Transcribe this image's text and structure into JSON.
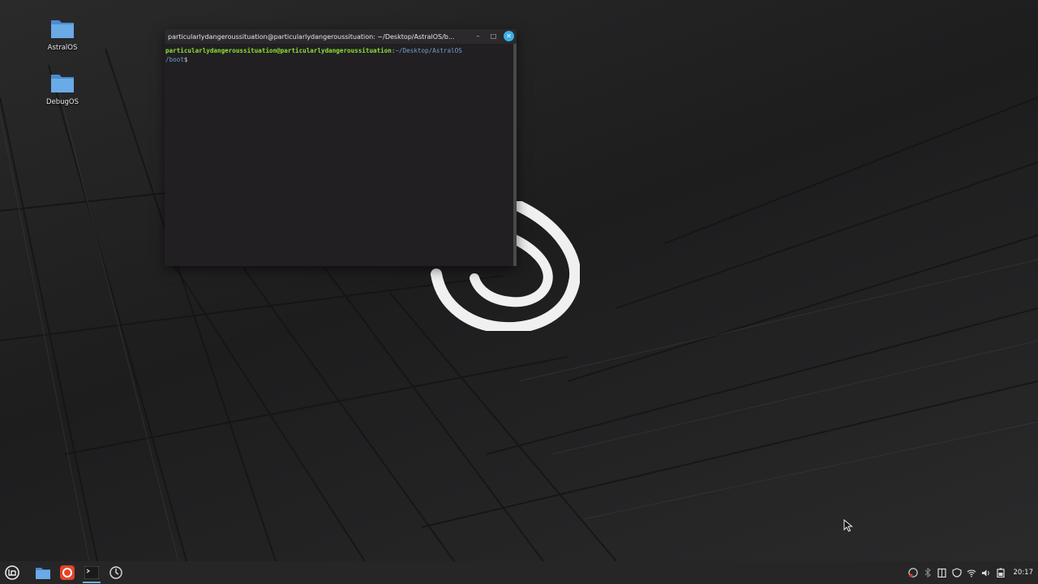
{
  "desktop": {
    "icons": [
      {
        "label": "AstralOS",
        "icon": "folder-icon"
      },
      {
        "label": "DebugOS",
        "icon": "folder-icon"
      }
    ]
  },
  "terminal": {
    "title": "particularlydangeroussituation@particularlydangeroussituation: ~/Desktop/AstralOS/b...",
    "prompt_user": "particularlydangeroussituation@particularlydangeroussituation",
    "prompt_sep": ":",
    "prompt_path": "~/Desktop/AstralOS",
    "prompt_path_cont": "/boot",
    "prompt_symbol": "$",
    "controls": {
      "minimize": "–",
      "maximize": "□",
      "close": "✕"
    }
  },
  "taskbar": {
    "buttons": [
      "mint-menu-icon",
      "files-icon",
      "firefox-icon",
      "terminal-icon",
      "timeshift-icon"
    ],
    "tray": [
      "update-icon",
      "bluetooth-icon",
      "clipboard-icon",
      "shield-icon",
      "wifi-icon",
      "volume-icon",
      "battery-icon"
    ],
    "clock": "20:17"
  },
  "colors": {
    "accent": "#3daee9",
    "prompt_user": "#8ae234",
    "prompt_path": "#729fcf",
    "folder": "#5b9bd8"
  }
}
